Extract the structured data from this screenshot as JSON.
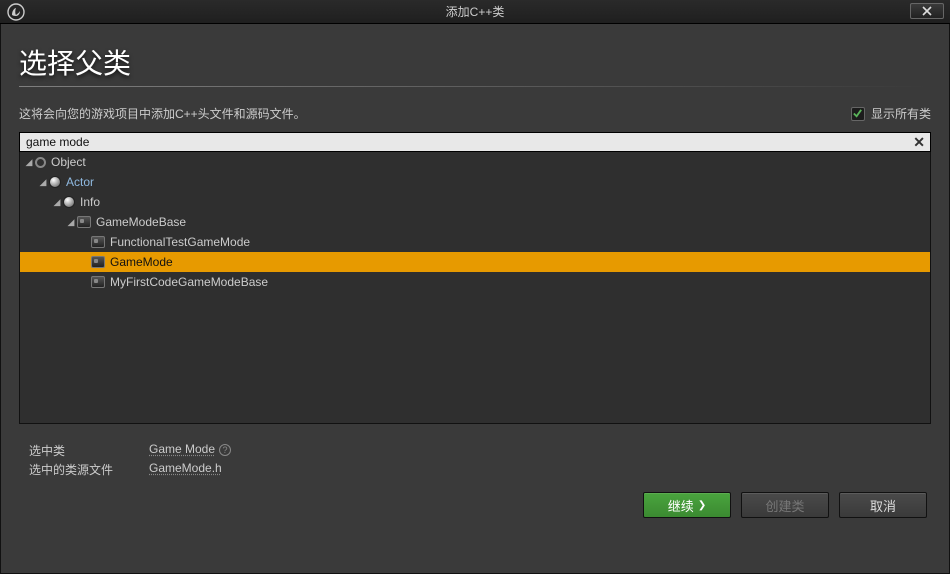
{
  "window": {
    "title": "添加C++类"
  },
  "page": {
    "heading": "选择父类",
    "description": "这将会向您的游戏项目中添加C++头文件和源码文件。",
    "show_all_classes_label": "显示所有类",
    "show_all_classes_checked": true
  },
  "search": {
    "value": "game mode",
    "placeholder": ""
  },
  "tree": [
    {
      "indent": 0,
      "label": "Object",
      "icon": "sphere-hollow",
      "expanded": true,
      "link": false
    },
    {
      "indent": 1,
      "label": "Actor",
      "icon": "sphere",
      "expanded": true,
      "link": true
    },
    {
      "indent": 2,
      "label": "Info",
      "icon": "sphere",
      "expanded": true,
      "link": false
    },
    {
      "indent": 3,
      "label": "GameModeBase",
      "icon": "class",
      "expanded": true,
      "link": false
    },
    {
      "indent": 4,
      "label": "FunctionalTestGameMode",
      "icon": "class",
      "expanded": false,
      "link": false
    },
    {
      "indent": 4,
      "label": "GameMode",
      "icon": "class",
      "expanded": false,
      "link": false,
      "selected": true
    },
    {
      "indent": 4,
      "label": "MyFirstCodeGameModeBase",
      "icon": "class",
      "expanded": false,
      "link": false
    }
  ],
  "selection": {
    "selected_class_label": "选中类",
    "selected_class_value": "Game Mode",
    "source_file_label": "选中的类源文件",
    "source_file_value": "GameMode.h"
  },
  "buttons": {
    "continue": "继续",
    "create_class": "创建类",
    "cancel": "取消"
  }
}
